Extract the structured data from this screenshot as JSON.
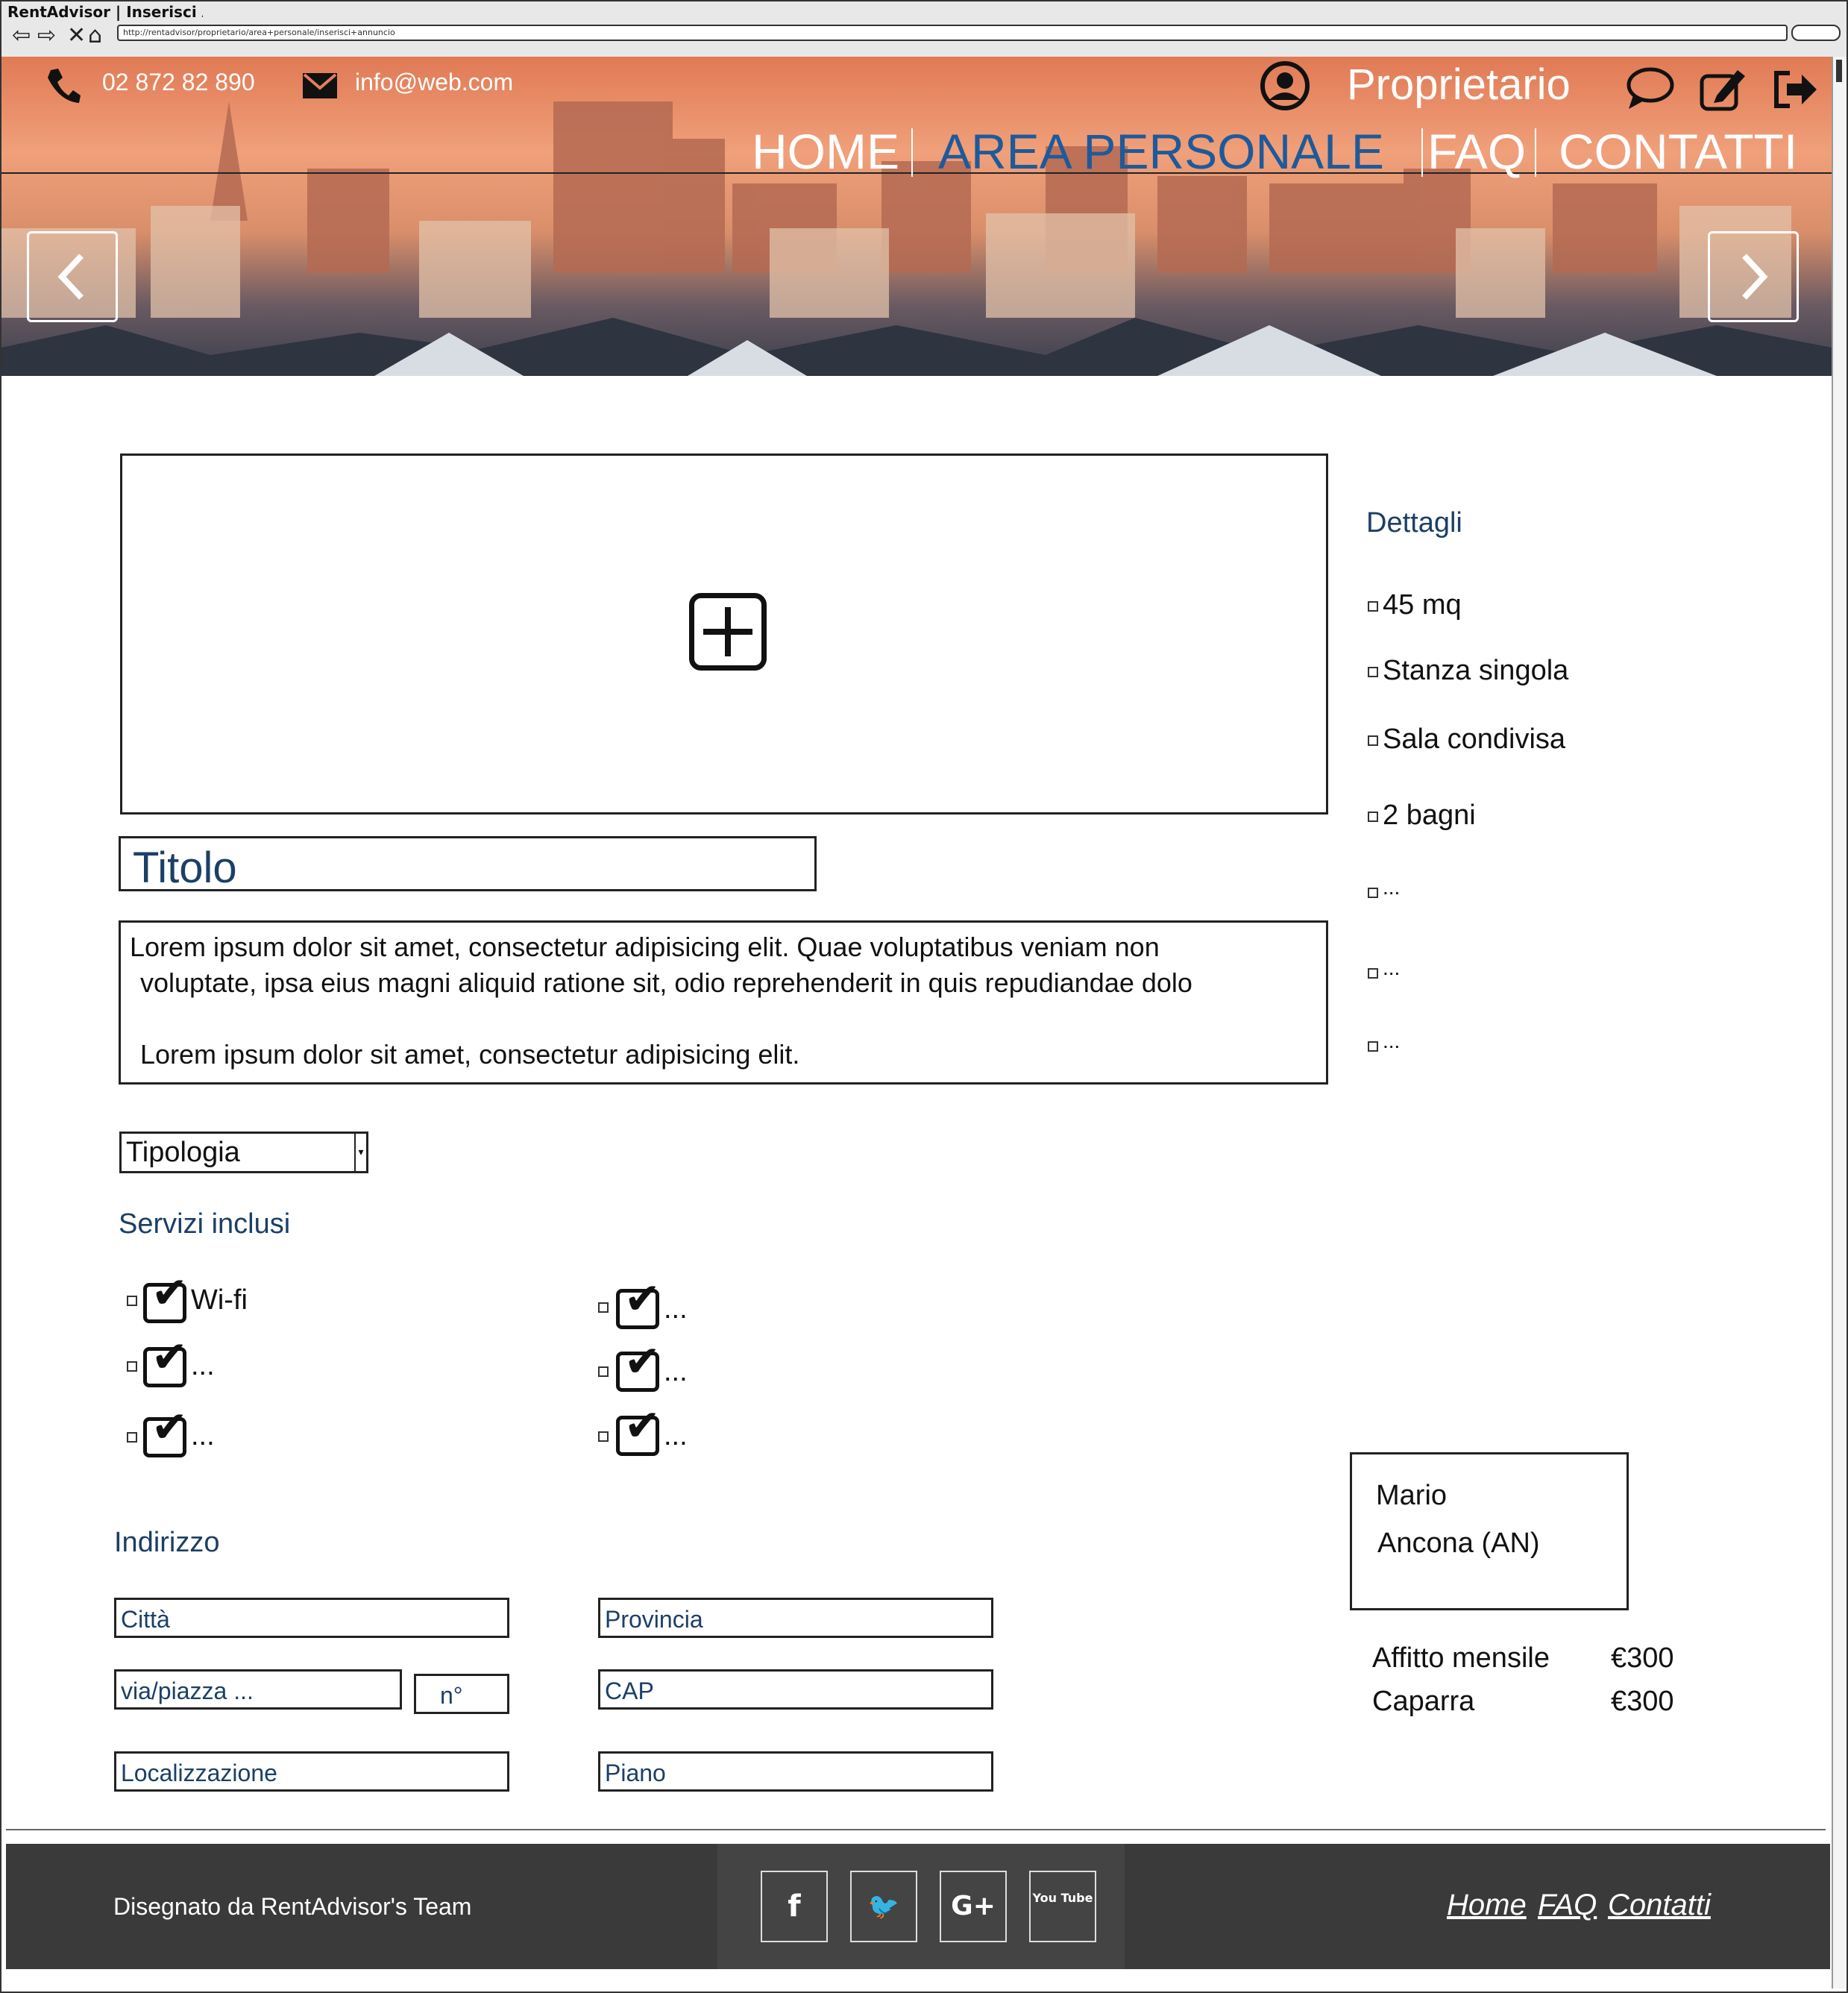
{
  "browser": {
    "title": "RentAdvisor | Inserisci Annuncio",
    "url": "http://rentadvisor/proprietario/area+personale/inserisci+annuncio"
  },
  "header": {
    "phone": "02 872 82 890",
    "email": "info@web.com",
    "role": "Proprietario",
    "nav": {
      "home": "HOME",
      "area": "AREA PERSONALE",
      "faq": "FAQ",
      "contatti": "CONTATTI"
    },
    "colors": {
      "active_nav": "#1e5a9a",
      "nav": "#ffffff"
    }
  },
  "listing": {
    "title_placeholder": "Titolo",
    "description": [
      "Lorem ipsum dolor sit amet, consectetur adipisicing elit. Quae voluptatibus veniam non",
      "voluptate, ipsa eius magni aliquid ratione sit, odio reprehenderit in quis repudiandae dolo",
      "Lorem ipsum dolor sit amet, consectetur adipisicing elit."
    ],
    "tipologia": "Tipologia"
  },
  "services": {
    "heading": "Servizi inclusi",
    "items": [
      "Wi-fi",
      "...",
      "...",
      "...",
      "...",
      "..."
    ]
  },
  "address": {
    "heading": "Indirizzo",
    "citta": "Città",
    "provincia": "Provincia",
    "via": "via/piazza ...",
    "numero": "n°",
    "cap": "CAP",
    "localizzazione": "Localizzazione",
    "piano": "Piano"
  },
  "details": {
    "heading": "Dettagli",
    "items": [
      "45 mq",
      "Stanza singola",
      "Sala condivisa",
      "2 bagni",
      "...",
      "...",
      "..."
    ]
  },
  "owner": {
    "name": "Mario",
    "city": "Ancona (AN)"
  },
  "prices": {
    "affitto_label": "Affitto mensile",
    "affitto_value": "€300",
    "caparra_label": "Caparra",
    "caparra_value": "€300"
  },
  "footer": {
    "credit": "Disegnato da RentAdvisor's Team",
    "social": {
      "facebook": "f",
      "twitter": "t",
      "google": "G+",
      "youtube": "You Tube"
    },
    "links": {
      "home": "Home",
      "faq": "FAQ",
      "contatti": "Contatti"
    }
  },
  "icons": [
    "phone-icon",
    "mail-icon",
    "user-icon",
    "chat-icon",
    "edit-icon",
    "logout-icon",
    "add-image-icon",
    "prev-arrow-icon",
    "next-arrow-icon"
  ]
}
